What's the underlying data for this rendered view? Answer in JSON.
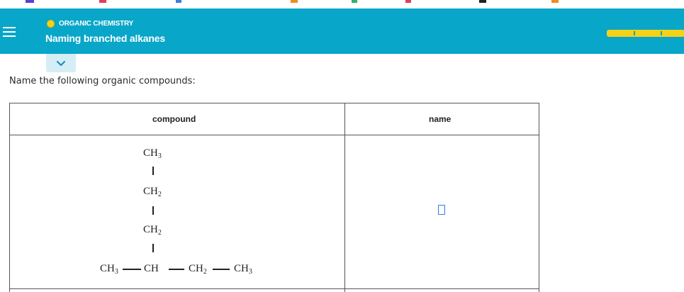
{
  "header": {
    "topic": "ORGANIC CHEMISTRY",
    "title": "Naming branched alkanes",
    "menu_icon": "hamburger-menu-icon",
    "chevron_icon": "chevron-down-icon",
    "progress_segments": 3,
    "accent_color": "#08a6c8",
    "progress_color": "#f5d218"
  },
  "question": {
    "prompt": "Name the following organic compounds:"
  },
  "table": {
    "headers": {
      "compound": "compound",
      "name": "name"
    },
    "rows": [
      {
        "structure": {
          "chain_vertical": [
            "CH3",
            "CH2",
            "CH2"
          ],
          "chain_horizontal": [
            "CH3",
            "CH",
            "CH2",
            "CH3"
          ]
        },
        "name_value": ""
      }
    ]
  }
}
